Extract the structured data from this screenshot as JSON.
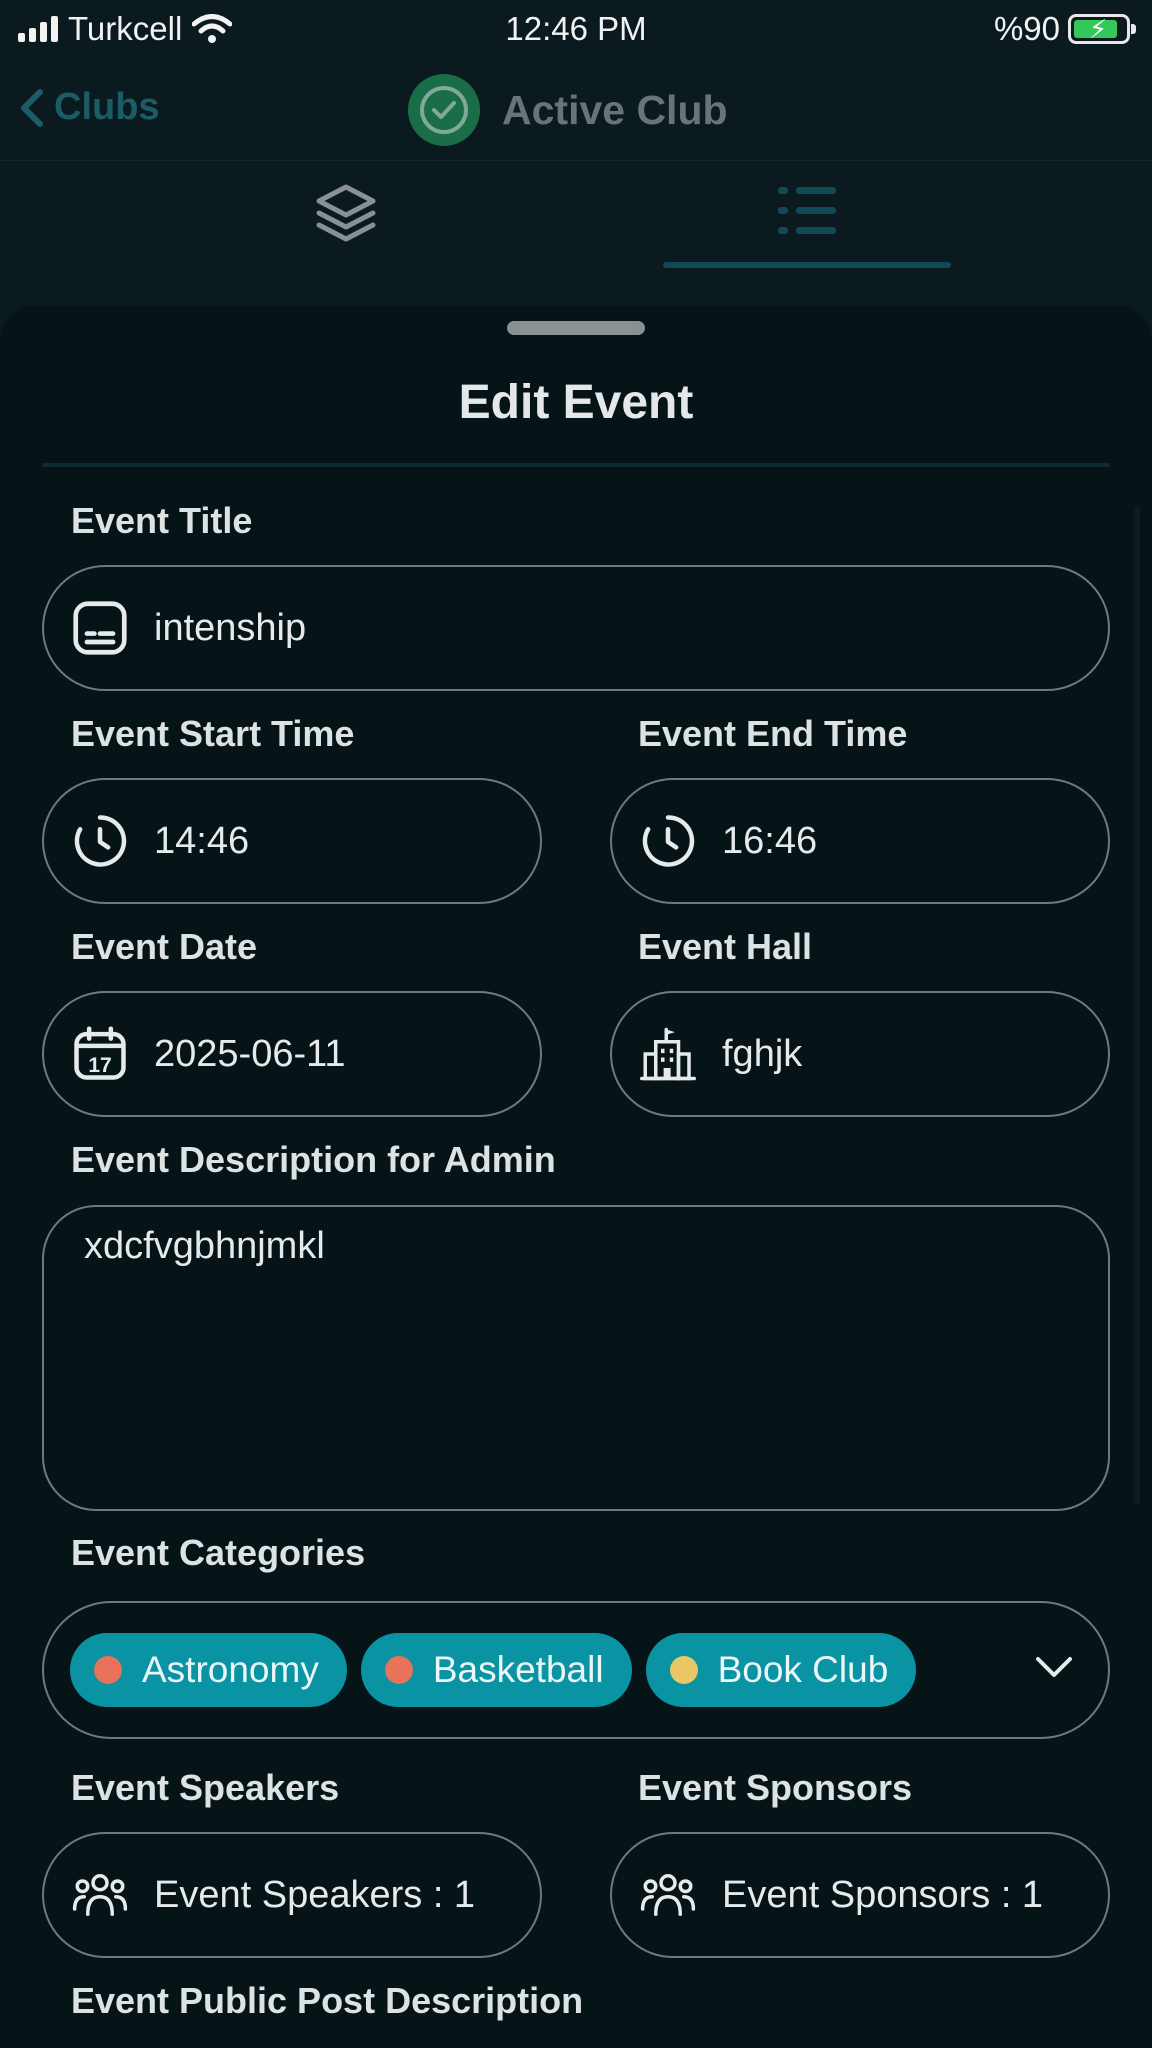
{
  "status_bar": {
    "carrier": "Turkcell",
    "time": "12:46 PM",
    "battery": "%90"
  },
  "nav": {
    "back_label": "Clubs",
    "title": "Active Club"
  },
  "tabs": [
    {
      "icon": "layers-icon",
      "selected": false
    },
    {
      "icon": "list-icon",
      "selected": true
    }
  ],
  "sheet": {
    "title": "Edit Event"
  },
  "form": {
    "event_title": {
      "label": "Event Title",
      "value": "intenship"
    },
    "start_time": {
      "label": "Event Start Time",
      "value": "14:46"
    },
    "end_time": {
      "label": "Event End Time",
      "value": "16:46"
    },
    "date": {
      "label": "Event Date",
      "value": "2025-06-11",
      "icon_day": "17"
    },
    "hall": {
      "label": "Event Hall",
      "value": "fghjk"
    },
    "admin_description": {
      "label": "Event Description for Admin",
      "value": "xdcfvgbhnjmkl"
    },
    "categories": {
      "label": "Event Categories",
      "chips": [
        {
          "name": "Astronomy",
          "color": "#e8725a"
        },
        {
          "name": "Basketball",
          "color": "#e8725a"
        },
        {
          "name": "Book Club",
          "color": "#e9c766"
        }
      ]
    },
    "speakers": {
      "label": "Event Speakers",
      "value": "Event Speakers : 1"
    },
    "sponsors": {
      "label": "Event Sponsors",
      "value": "Event Sponsors : 1"
    },
    "public_description": {
      "label": "Event Public Post Description"
    }
  }
}
